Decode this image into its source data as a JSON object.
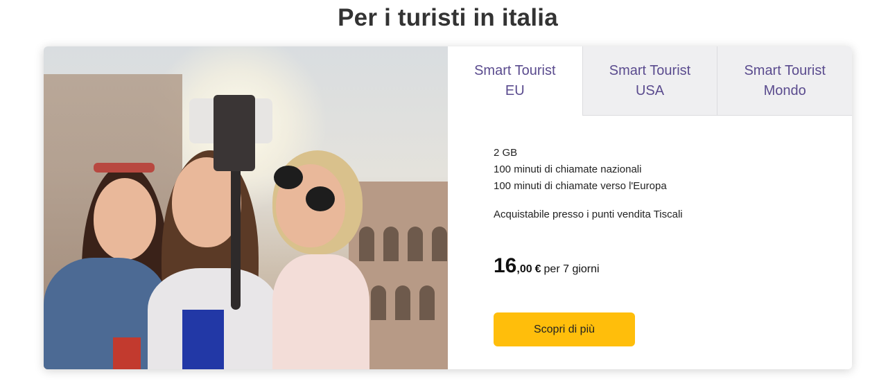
{
  "section": {
    "title": "Per i turisti in italia"
  },
  "tabs": [
    {
      "line1": "Smart Tourist",
      "line2": "EU",
      "active": true
    },
    {
      "line1": "Smart Tourist",
      "line2": "USA",
      "active": false
    },
    {
      "line1": "Smart Tourist",
      "line2": "Mondo",
      "active": false
    }
  ],
  "offer": {
    "features": [
      "2 GB",
      "100 minuti di chiamate nazionali",
      "100 minuti di chiamate verso l'Europa"
    ],
    "availability": "Acquistabile presso i punti vendita Tiscali",
    "price": {
      "integer": "16",
      "decimal": ",00",
      "currency": "€",
      "period": "per 7 giorni"
    },
    "cta_label": "Scopri di più"
  },
  "colors": {
    "accent": "#ffbe0b",
    "tab_text": "#5a4b8e",
    "tab_inactive_bg": "#efeff1"
  },
  "hero_image": {
    "subject": "three tourists taking a selfie in front of the Colosseum"
  }
}
